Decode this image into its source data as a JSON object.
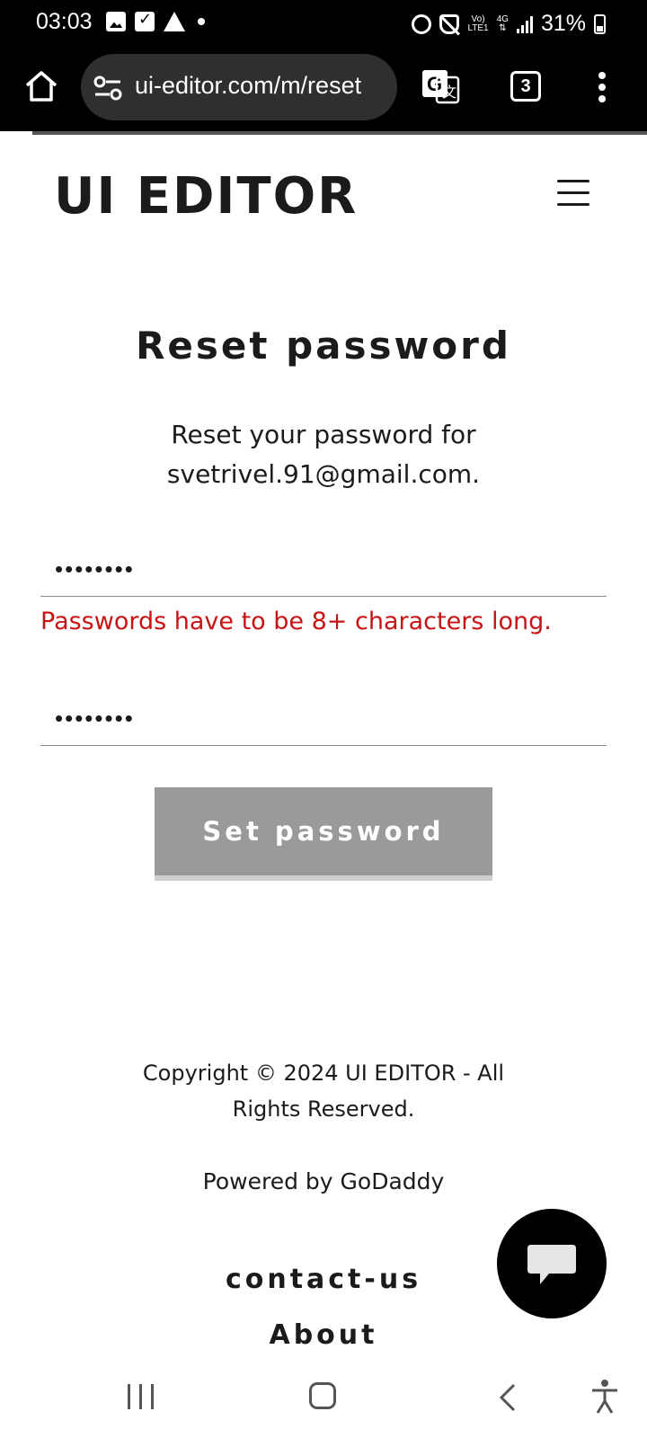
{
  "status_bar": {
    "time": "03:03",
    "network_top": "Vo)",
    "network_bottom": "LTE1",
    "network_type": "4G",
    "battery": "31%"
  },
  "browser": {
    "url": "ui-editor.com/m/reset",
    "tab_count": "3",
    "page_load_progress": 0.05
  },
  "site": {
    "logo": "UI EDITOR"
  },
  "form": {
    "title": "Reset password",
    "subtitle": "Reset your password for svetrivel.91@gmail.com.",
    "password_value": "••••••••",
    "confirm_value": "••••••••",
    "error": "Passwords have to be 8+ characters long.",
    "submit_label": "Set password"
  },
  "footer": {
    "copyright": "Copyright © 2024 UI EDITOR - All Rights Reserved.",
    "powered_prefix": "Powered by ",
    "powered_link": "GoDaddy",
    "links": [
      "contact-us",
      "About"
    ]
  },
  "icons": {
    "home": "home-icon",
    "site_info": "tune-icon",
    "translate": "translate-icon",
    "menu": "more-vert-icon",
    "hamburger": "hamburger-menu-icon",
    "chat": "chat-bubble-icon"
  },
  "colors": {
    "error": "#c81414",
    "button_disabled": "#9a9a9a",
    "text": "#1b1b1b"
  }
}
